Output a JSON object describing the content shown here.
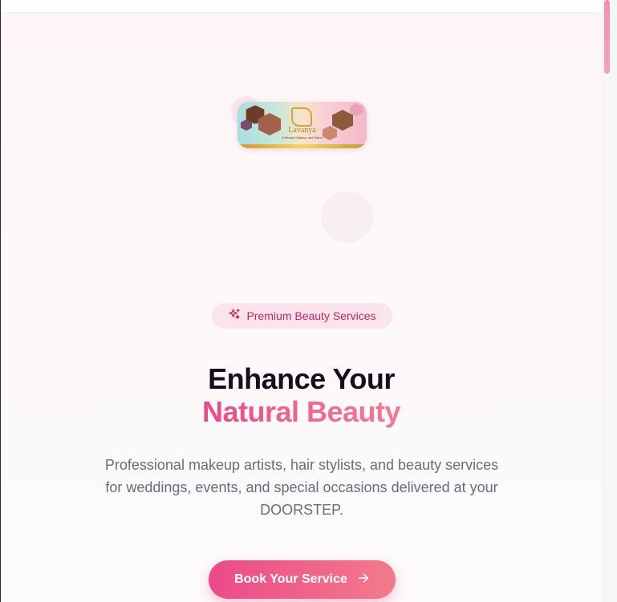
{
  "logo": {
    "brand_name": "Lavanya",
    "tagline": "A Beauty Makeup and Salon"
  },
  "hero": {
    "badge_label": "Premium Beauty Services",
    "title_line1": "Enhance Your",
    "title_line2": "Natural Beauty",
    "subtitle": "Professional makeup artists, hair stylists, and beauty services for weddings, events, and special occasions delivered at your DOORSTEP.",
    "cta_label": "Book Your Service"
  },
  "colors": {
    "accent": "#ec4a89",
    "title_dark": "#14101f",
    "badge_bg": "#fbe4ec",
    "badge_text": "#c2255c",
    "body_text": "#6b6b7b"
  },
  "icons": {
    "badge_icon": "sparkles-icon",
    "cta_icon": "arrow-right-icon"
  }
}
